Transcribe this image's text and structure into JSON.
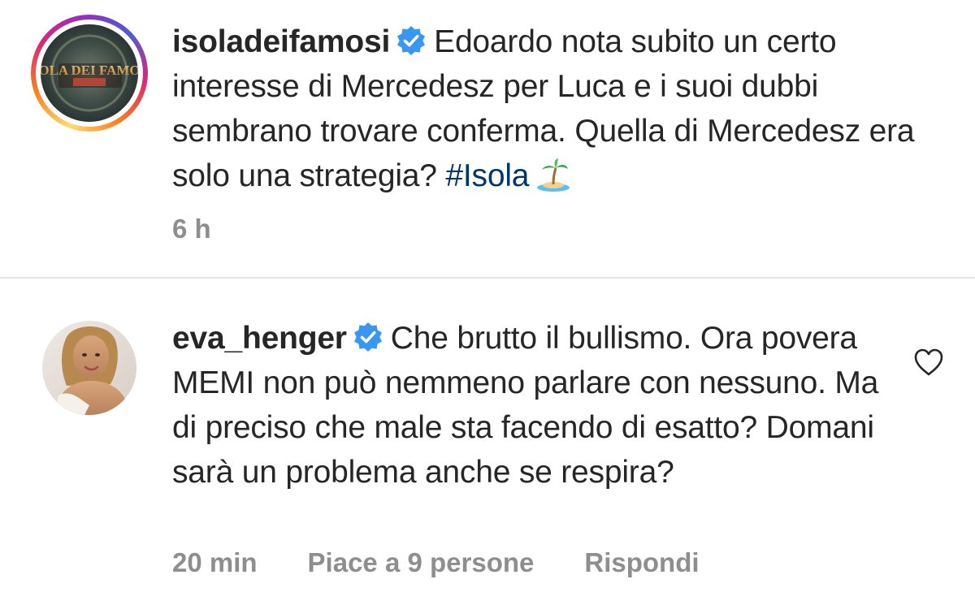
{
  "post": {
    "username": "isoladeifamosi",
    "avatar_label": "ISOLA DEI FAMOSI",
    "caption": "Edoardo nota subito un certo interesse di Mercedesz per Luca e i suoi dubbi sembrano trovare conferma. Quella di Mercedesz era solo una strategia?",
    "hashtag": "#Isola",
    "emoji": "island-emoji",
    "time": "6 h",
    "verified_icon": "verified-badge-icon"
  },
  "comment": {
    "username": "eva_henger",
    "text": "Che brutto il bullismo. Ora povera MEMI non può nemmeno parlare con nessuno. Ma di preciso che male sta facendo di esatto? Domani sarà un problema anche se respira?",
    "time": "20 min",
    "likes": "Piace a 9 persone",
    "reply": "Rispondi",
    "like_icon": "heart-icon",
    "verified_icon": "verified-badge-icon"
  },
  "colors": {
    "text": "#262626",
    "meta": "#8e8e8e",
    "hashtag": "#00376b",
    "verified": "#3897f0",
    "divider": "#e4e4e4"
  }
}
